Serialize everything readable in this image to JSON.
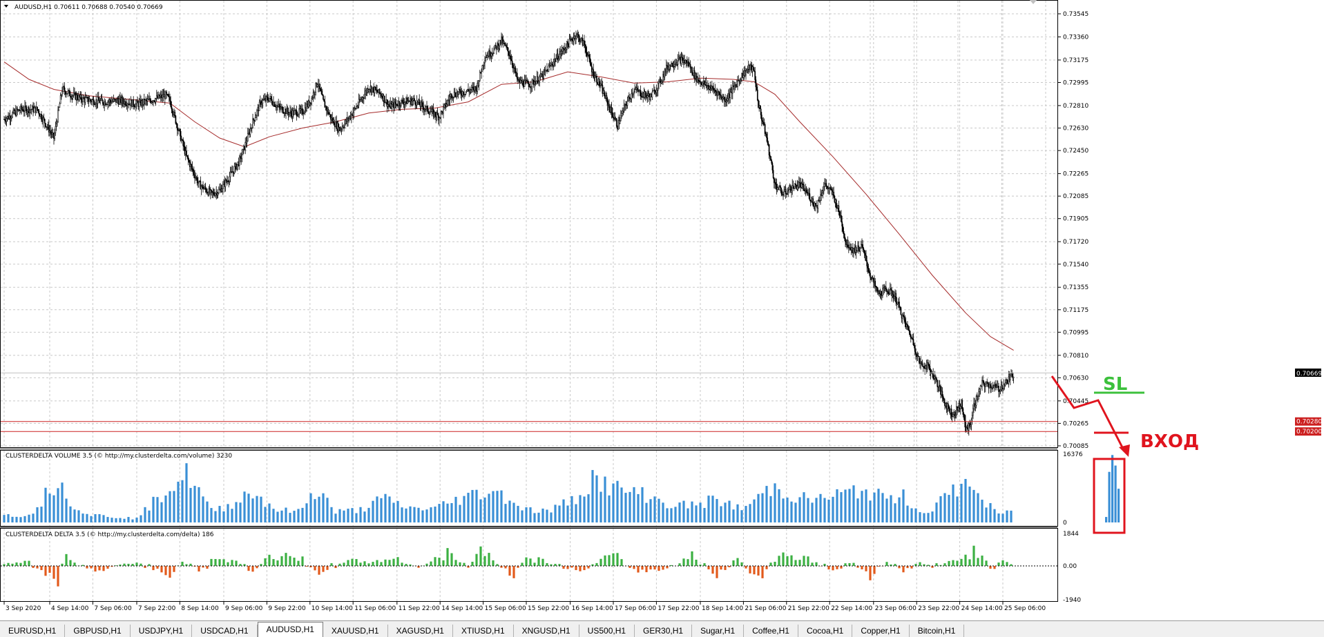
{
  "colors": {
    "bull": "#3cb043",
    "bear": "#e25a1c",
    "volume": "#3a8fd6",
    "ma": "#a52a2a",
    "level": "#cc2020",
    "annotation": "#e0141e",
    "sl": "#3cc03c",
    "grid": "#c8c8c8"
  },
  "main_title": "AUDUSD,H1  0.70611 0.70688 0.70540 0.70669",
  "volume_title": "CLUSTERDELTA VOLUME 3.5 (© http://my.clusterdelta.com/volume) 3230",
  "delta_title": "CLUSTERDELTA DELTA 3.5 (© http://my.clusterdelta.com/delta) 186",
  "current_price": "0.70669",
  "annotations": {
    "sl": "SL",
    "entry": "ВХОД"
  },
  "chart_data": [
    {
      "type": "candlestick",
      "symbol": "AUDUSD",
      "timeframe": "H1",
      "ylim": [
        0.70085,
        0.73545
      ],
      "y_ticks": [
        "0.73545",
        "0.73360",
        "0.73175",
        "0.72995",
        "0.72810",
        "0.72630",
        "0.72450",
        "0.72265",
        "0.72085",
        "0.71905",
        "0.71720",
        "0.71540",
        "0.71355",
        "0.71175",
        "0.70995",
        "0.70810",
        "0.70630",
        "0.70445",
        "0.70265",
        "0.70085"
      ],
      "levels": [
        "0.70280",
        "0.70200"
      ],
      "close_path": [
        [
          0,
          0.727
        ],
        [
          20,
          0.7278
        ],
        [
          40,
          0.7278
        ],
        [
          60,
          0.7255
        ],
        [
          70,
          0.7294
        ],
        [
          80,
          0.729
        ],
        [
          95,
          0.7286
        ],
        [
          120,
          0.7284
        ],
        [
          140,
          0.7285
        ],
        [
          160,
          0.7282
        ],
        [
          180,
          0.7286
        ],
        [
          195,
          0.7289
        ],
        [
          200,
          0.7285
        ],
        [
          210,
          0.7262
        ],
        [
          220,
          0.724
        ],
        [
          235,
          0.7218
        ],
        [
          250,
          0.721
        ],
        [
          260,
          0.7213
        ],
        [
          270,
          0.7222
        ],
        [
          285,
          0.7238
        ],
        [
          300,
          0.7268
        ],
        [
          310,
          0.7284
        ],
        [
          320,
          0.7287
        ],
        [
          330,
          0.728
        ],
        [
          345,
          0.7275
        ],
        [
          360,
          0.7276
        ],
        [
          370,
          0.7285
        ],
        [
          378,
          0.73
        ],
        [
          385,
          0.7284
        ],
        [
          395,
          0.727
        ],
        [
          405,
          0.7262
        ],
        [
          415,
          0.727
        ],
        [
          430,
          0.7285
        ],
        [
          440,
          0.7296
        ],
        [
          455,
          0.729
        ],
        [
          465,
          0.728
        ],
        [
          480,
          0.7284
        ],
        [
          495,
          0.7285
        ],
        [
          510,
          0.7278
        ],
        [
          525,
          0.7272
        ],
        [
          540,
          0.729
        ],
        [
          555,
          0.7292
        ],
        [
          570,
          0.7295
        ],
        [
          580,
          0.732
        ],
        [
          590,
          0.7325
        ],
        [
          600,
          0.7333
        ],
        [
          610,
          0.7322
        ],
        [
          620,
          0.73
        ],
        [
          635,
          0.7298
        ],
        [
          650,
          0.7305
        ],
        [
          665,
          0.7318
        ],
        [
          680,
          0.733
        ],
        [
          690,
          0.7338
        ],
        [
          700,
          0.733
        ],
        [
          710,
          0.7308
        ],
        [
          720,
          0.7296
        ],
        [
          730,
          0.728
        ],
        [
          740,
          0.7265
        ],
        [
          750,
          0.7282
        ],
        [
          760,
          0.7294
        ],
        [
          770,
          0.729
        ],
        [
          780,
          0.7288
        ],
        [
          790,
          0.7298
        ],
        [
          800,
          0.7312
        ],
        [
          815,
          0.7318
        ],
        [
          825,
          0.7315
        ],
        [
          835,
          0.7303
        ],
        [
          845,
          0.7298
        ],
        [
          860,
          0.7292
        ],
        [
          870,
          0.7285
        ],
        [
          880,
          0.7295
        ],
        [
          890,
          0.7305
        ],
        [
          900,
          0.7312
        ],
        [
          905,
          0.7308
        ],
        [
          910,
          0.7282
        ],
        [
          920,
          0.7255
        ],
        [
          930,
          0.7218
        ],
        [
          940,
          0.721
        ],
        [
          950,
          0.7215
        ],
        [
          960,
          0.7218
        ],
        [
          970,
          0.721
        ],
        [
          980,
          0.72
        ],
        [
          990,
          0.7218
        ],
        [
          1000,
          0.721
        ],
        [
          1010,
          0.719
        ],
        [
          1015,
          0.7172
        ],
        [
          1025,
          0.7165
        ],
        [
          1035,
          0.7168
        ],
        [
          1045,
          0.7145
        ],
        [
          1055,
          0.713
        ],
        [
          1065,
          0.7134
        ],
        [
          1075,
          0.7128
        ],
        [
          1085,
          0.711
        ],
        [
          1095,
          0.7095
        ],
        [
          1105,
          0.7074
        ],
        [
          1115,
          0.7072
        ],
        [
          1125,
          0.706
        ],
        [
          1135,
          0.7043
        ],
        [
          1145,
          0.7033
        ],
        [
          1155,
          0.7043
        ],
        [
          1160,
          0.7022
        ],
        [
          1165,
          0.7024
        ],
        [
          1170,
          0.704
        ],
        [
          1180,
          0.7058
        ],
        [
          1190,
          0.7057
        ],
        [
          1200,
          0.7054
        ],
        [
          1210,
          0.706
        ],
        [
          1218,
          0.7066
        ]
      ],
      "ma_path": [
        [
          0,
          0.7316
        ],
        [
          30,
          0.7302
        ],
        [
          60,
          0.7294
        ],
        [
          100,
          0.7289
        ],
        [
          150,
          0.7286
        ],
        [
          200,
          0.7283
        ],
        [
          230,
          0.7268
        ],
        [
          260,
          0.7255
        ],
        [
          290,
          0.7248
        ],
        [
          320,
          0.7256
        ],
        [
          360,
          0.7263
        ],
        [
          400,
          0.7268
        ],
        [
          440,
          0.7275
        ],
        [
          480,
          0.7278
        ],
        [
          520,
          0.7279
        ],
        [
          560,
          0.7284
        ],
        [
          600,
          0.7298
        ],
        [
          640,
          0.73
        ],
        [
          680,
          0.7308
        ],
        [
          720,
          0.7304
        ],
        [
          760,
          0.7299
        ],
        [
          800,
          0.73
        ],
        [
          840,
          0.7303
        ],
        [
          880,
          0.7302
        ],
        [
          905,
          0.73
        ],
        [
          930,
          0.729
        ],
        [
          960,
          0.7268
        ],
        [
          1000,
          0.724
        ],
        [
          1040,
          0.721
        ],
        [
          1080,
          0.7178
        ],
        [
          1120,
          0.7145
        ],
        [
          1160,
          0.7115
        ],
        [
          1190,
          0.7096
        ],
        [
          1218,
          0.7085
        ]
      ]
    },
    {
      "type": "bar",
      "name": "CLUSTERDELTA VOLUME",
      "ylim": [
        0,
        16376
      ],
      "y_ticks": [
        "16376",
        "0"
      ],
      "peaks": [
        [
          0,
          2600
        ],
        [
          30,
          2000
        ],
        [
          65,
          13200
        ],
        [
          78,
          7000
        ],
        [
          100,
          2500
        ],
        [
          130,
          1800
        ],
        [
          160,
          1200
        ],
        [
          200,
          11000
        ],
        [
          222,
          14800
        ],
        [
          250,
          3500
        ],
        [
          270,
          5000
        ],
        [
          298,
          9500
        ],
        [
          330,
          3800
        ],
        [
          355,
          3300
        ],
        [
          378,
          10500
        ],
        [
          400,
          3200
        ],
        [
          430,
          3900
        ],
        [
          457,
          7300
        ],
        [
          490,
          4300
        ],
        [
          520,
          4400
        ],
        [
          555,
          7800
        ],
        [
          590,
          10000
        ],
        [
          630,
          4000
        ],
        [
          655,
          3400
        ],
        [
          690,
          7300
        ],
        [
          710,
          13700
        ],
        [
          735,
          10500
        ],
        [
          775,
          8400
        ],
        [
          800,
          5500
        ],
        [
          830,
          5200
        ],
        [
          860,
          7000
        ],
        [
          890,
          4000
        ],
        [
          928,
          11000
        ],
        [
          960,
          7300
        ],
        [
          985,
          7200
        ],
        [
          1010,
          8700
        ],
        [
          1040,
          9900
        ],
        [
          1060,
          7400
        ],
        [
          1085,
          7900
        ],
        [
          1110,
          2600
        ],
        [
          1130,
          6500
        ],
        [
          1165,
          13000
        ],
        [
          1180,
          6500
        ],
        [
          1200,
          2700
        ],
        [
          1218,
          3200
        ]
      ],
      "entry_box_bars": [
        1300,
        12000,
        16000,
        13500,
        8000
      ],
      "x_ticks": [
        [
          "3 Sep 2020",
          0
        ],
        [
          "4 Sep 14:00",
          55
        ],
        [
          "7 Sep 06:00",
          107
        ],
        [
          "7 Sep 22:00",
          160
        ],
        [
          "8 Sep 14:00",
          212
        ],
        [
          "9 Sep 06:00",
          265
        ],
        [
          "9 Sep 22:00",
          317
        ],
        [
          "10 Sep 14:00",
          369
        ],
        [
          "11 Sep 06:00",
          421
        ],
        [
          "11 Sep 22:00",
          474
        ],
        [
          "14 Sep 14:00",
          526
        ],
        [
          "15 Sep 06:00",
          578
        ],
        [
          "15 Sep 22:00",
          630
        ],
        [
          "16 Sep 14:00",
          683
        ],
        [
          "17 Sep 06:00",
          735
        ],
        [
          "17 Sep 22:00",
          787
        ],
        [
          "18 Sep 14:00",
          840
        ],
        [
          "21 Sep 06:00",
          892
        ],
        [
          "21 Sep 22:00",
          944
        ],
        [
          "22 Sep 14:00",
          996
        ],
        [
          "23 Sep 06:00",
          1049
        ],
        [
          "23 Sep 22:00",
          1101
        ],
        [
          "24 Sep 14:00",
          1153
        ],
        [
          "25 Sep 06:00",
          1205
        ]
      ]
    },
    {
      "type": "bar",
      "name": "CLUSTERDELTA DELTA",
      "ylim": [
        -1940,
        1844
      ],
      "y_ticks": [
        "1844",
        "0.00",
        "-1940"
      ],
      "peaks": [
        [
          20,
          300
        ],
        [
          30,
          350
        ],
        [
          65,
          -1500
        ],
        [
          72,
          800
        ],
        [
          80,
          500
        ],
        [
          100,
          -200
        ],
        [
          120,
          -400
        ],
        [
          160,
          300
        ],
        [
          200,
          -800
        ],
        [
          215,
          300
        ],
        [
          235,
          -300
        ],
        [
          250,
          350
        ],
        [
          278,
          500
        ],
        [
          300,
          -500
        ],
        [
          320,
          800
        ],
        [
          360,
          500
        ],
        [
          380,
          -500
        ],
        [
          410,
          400
        ],
        [
          440,
          300
        ],
        [
          470,
          600
        ],
        [
          500,
          -200
        ],
        [
          535,
          1000
        ],
        [
          560,
          -200
        ],
        [
          574,
          1700
        ],
        [
          590,
          400
        ],
        [
          615,
          -900
        ],
        [
          625,
          500
        ],
        [
          650,
          500
        ],
        [
          680,
          -200
        ],
        [
          700,
          -300
        ],
        [
          735,
          900
        ],
        [
          760,
          -400
        ],
        [
          800,
          -300
        ],
        [
          830,
          800
        ],
        [
          860,
          -900
        ],
        [
          885,
          700
        ],
        [
          908,
          -1300
        ],
        [
          935,
          1100
        ],
        [
          950,
          800
        ],
        [
          975,
          400
        ],
        [
          1000,
          -400
        ],
        [
          1020,
          400
        ],
        [
          1045,
          -800
        ],
        [
          1065,
          400
        ],
        [
          1085,
          -400
        ],
        [
          1105,
          300
        ],
        [
          1120,
          -200
        ],
        [
          1140,
          300
        ],
        [
          1165,
          1000
        ],
        [
          1175,
          1200
        ],
        [
          1190,
          -200
        ],
        [
          1205,
          500
        ],
        [
          1215,
          200
        ]
      ]
    }
  ],
  "tabs": [
    "EURUSD,H1",
    "GBPUSD,H1",
    "USDJPY,H1",
    "USDCAD,H1",
    "AUDUSD,H1",
    "XAUUSD,H1",
    "XAGUSD,H1",
    "XTIUSD,H1",
    "XNGUSD,H1",
    "US500,H1",
    "GER30,H1",
    "Sugar,H1",
    "Coffee,H1",
    "Cocoa,H1",
    "Copper,H1",
    "Bitcoin,H1"
  ],
  "active_tab": 4
}
